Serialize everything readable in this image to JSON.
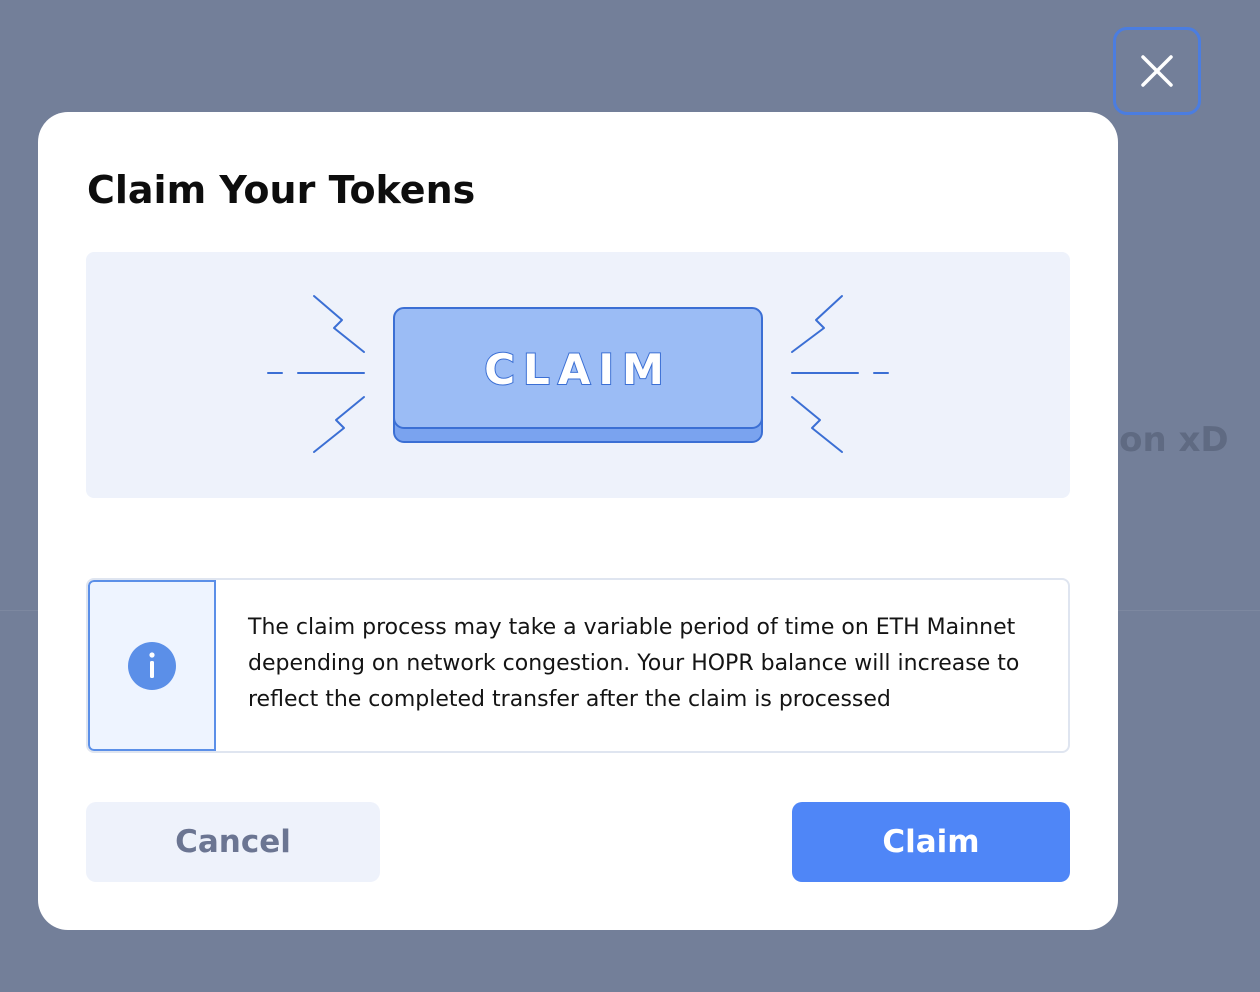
{
  "background": {
    "partial_text": "en on xD"
  },
  "modal": {
    "title": "Claim Your Tokens",
    "illustration": {
      "button_label": "CLAIM"
    },
    "info": {
      "icon": "info-icon",
      "message": "The claim process may take a variable period of time on ETH Mainnet depending on network congestion. Your HOPR balance will increase to reflect the completed transfer after the claim is processed"
    },
    "buttons": {
      "cancel_label": "Cancel",
      "claim_label": "Claim"
    }
  },
  "close_button": {
    "icon": "close-icon"
  },
  "colors": {
    "overlay": "#737f99",
    "primary": "#4f86f7",
    "illustration_bg": "#eef2fb",
    "illustration_button": "#9bbcf5",
    "illustration_stroke": "#3b6fd4",
    "cancel_text": "#6b7592"
  }
}
